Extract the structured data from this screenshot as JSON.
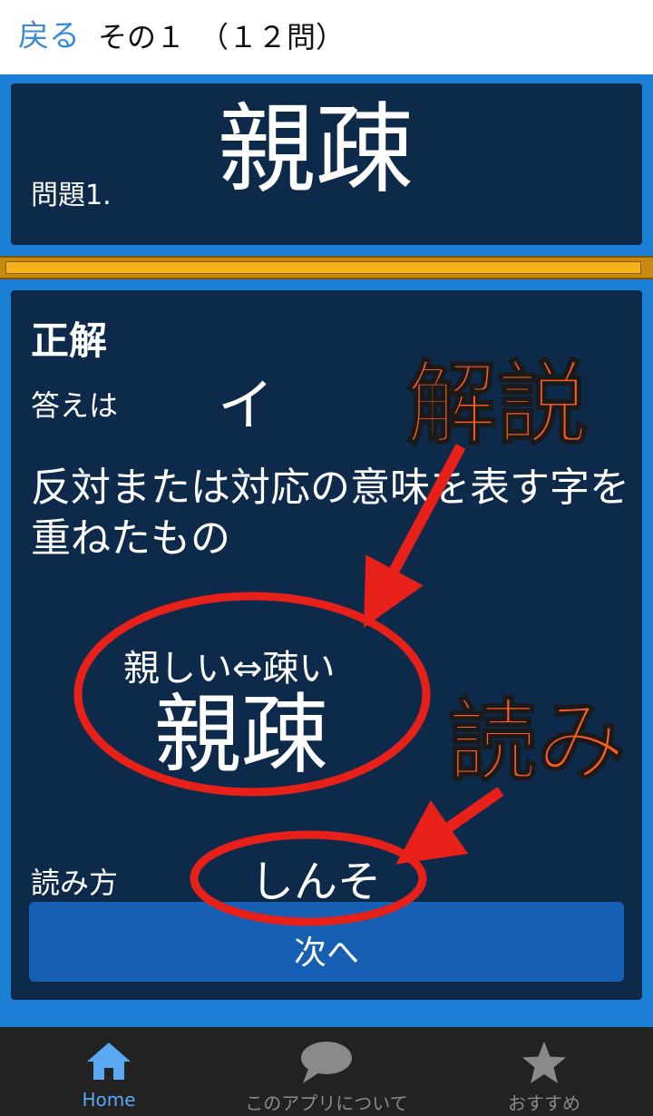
{
  "header": {
    "back_label": "戻る",
    "title": "その１　（１２問）"
  },
  "question": {
    "label": "問題1.",
    "word": "親疎"
  },
  "progress": {
    "fraction": 0.99
  },
  "answer": {
    "result_label": "正解",
    "answer_label": "答えは",
    "answer_value": "イ",
    "explanation": "反対または対応の意味を表す字を重ねたもの",
    "example_reading": "親しい⇔疎い",
    "example_word": "親疎",
    "reading_label": "読み方",
    "reading_value": "しんそ",
    "next_label": "次へ"
  },
  "annotations": {
    "explanation": "解説",
    "reading": "読み",
    "circle_color": "#e8201a",
    "text_color": "#ff5a1f"
  },
  "nav": {
    "home_label": "Home",
    "about_label": "このアプリについて",
    "recommend_label": "おすすめ",
    "home_icon": "home-icon",
    "about_icon": "chat-bubble-icon",
    "recommend_icon": "star-icon"
  }
}
